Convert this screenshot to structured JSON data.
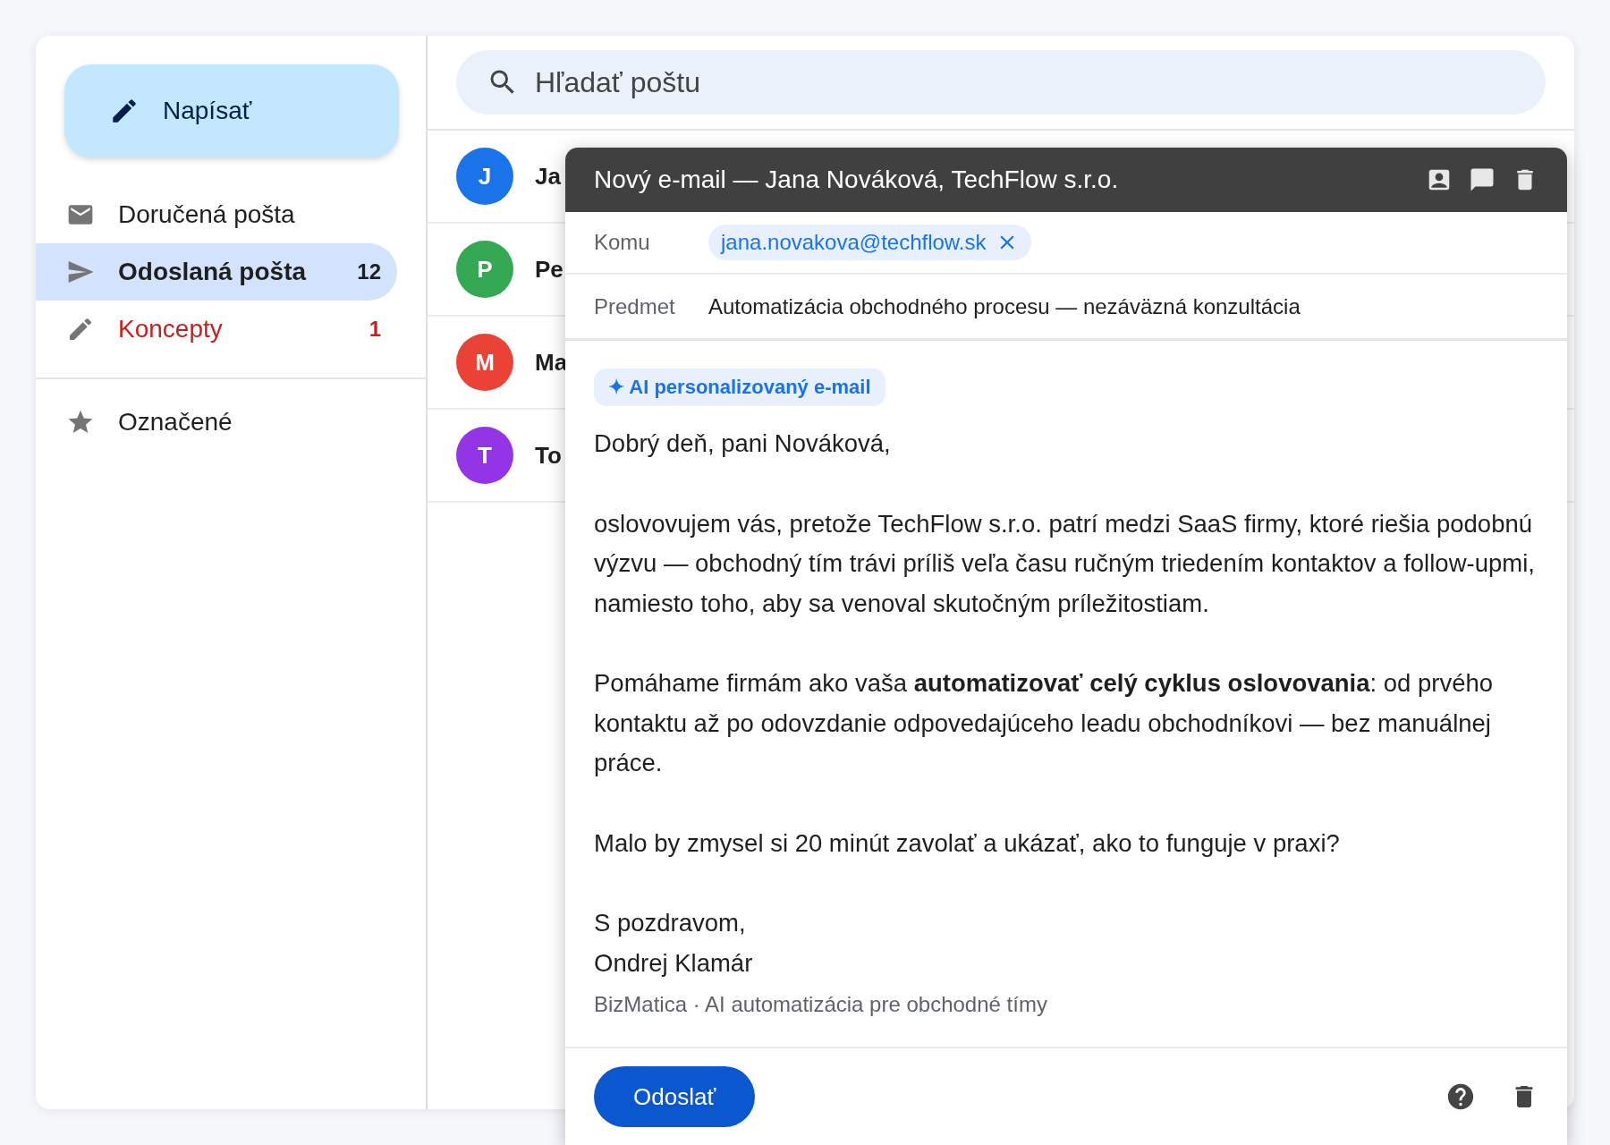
{
  "sidebar": {
    "compose_button": "Napísať",
    "items": [
      {
        "label": "Doručená pošta",
        "selected": false,
        "kind": "normal"
      },
      {
        "label": "Odoslaná pošta",
        "count": "12",
        "selected": true,
        "kind": "normal"
      },
      {
        "label": "Koncepty",
        "count": "1",
        "selected": false,
        "kind": "alert"
      }
    ],
    "secondary_items": [
      {
        "label": "Označené",
        "selected": false
      }
    ]
  },
  "search": {
    "placeholder": "Hľadať poštu"
  },
  "mail_list": [
    {
      "initial": "J",
      "color": "#1a73e8",
      "sender": "Ja"
    },
    {
      "initial": "P",
      "color": "#34a853",
      "sender": "Pe"
    },
    {
      "initial": "M",
      "color": "#ea4335",
      "sender": "Ma"
    },
    {
      "initial": "T",
      "color": "#9334e6",
      "sender": "To"
    }
  ],
  "compose": {
    "title": "Nový e-mail — Jana Nováková, TechFlow s.r.o.",
    "to_label": "Komu",
    "recipient": "jana.novakova@techflow.sk",
    "subject_label": "Predmet",
    "subject": "Automatizácia obchodného procesu — nezáväzná konzultácia",
    "badge": "✦ AI personalizovaný e-mail",
    "paragraphs": [
      "Dobrý deň, pani Nováková,",
      "oslovovujem vás, pretože TechFlow s.r.o. patrí medzi SaaS firmy, ktoré riešia podobnú výzvu — obchodný tím trávi príliš veľa času ručným triedením kontaktov a follow-upmi, namiesto toho, aby sa venoval skutočným príležitostiam.",
      "Pomáhame firmám ako vaša **automatizovať celý cyklus oslovovania**: od prvého kontaktu až po odovzdanie odpovedajúceho leadu obchodníkovi — bez manuálnej práce.",
      "Malo by zmysel si 20 minút zavolať a ukázať, ako to funguje v praxi?"
    ],
    "signature": [
      "S pozdravom,",
      "Ondrej Klamár"
    ],
    "signature_note": "BizMatica · AI automatizácia pre obchodné tímy",
    "send_button": "Odoslať"
  }
}
